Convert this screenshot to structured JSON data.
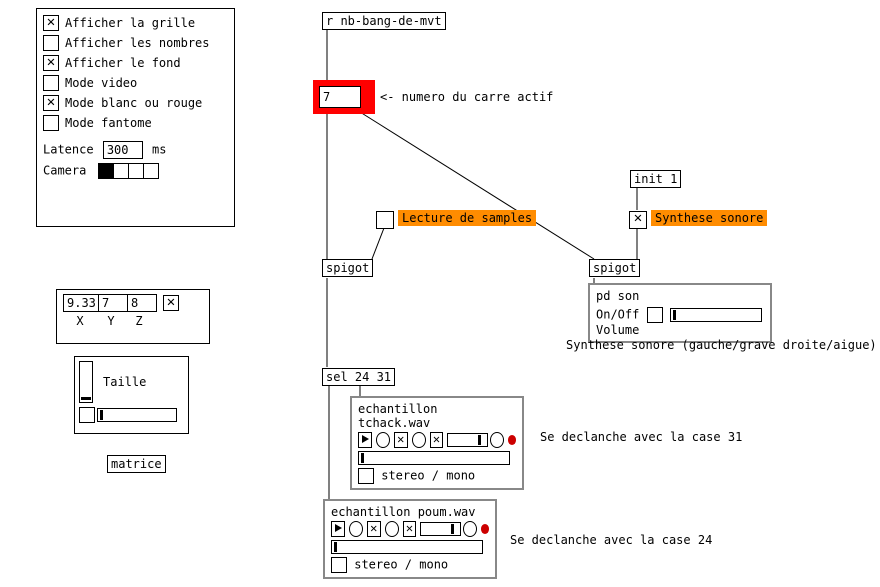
{
  "header": {
    "receive": "r nb-bang-de-mvt",
    "active_label": "<- numero du carre actif",
    "active_value": "7"
  },
  "options": {
    "items": [
      {
        "label": "Afficher la grille",
        "checked": true
      },
      {
        "label": "Afficher les nombres",
        "checked": false
      },
      {
        "label": "Afficher le fond",
        "checked": true
      },
      {
        "label": "Mode video",
        "checked": false
      },
      {
        "label": "Mode blanc ou rouge",
        "checked": true
      },
      {
        "label": "Mode fantome",
        "checked": false
      }
    ],
    "latency_label": "Latence",
    "latency_value": "300",
    "latency_unit": "ms",
    "camera_label": "Camera"
  },
  "xyz": {
    "x": "9.33",
    "y": "7",
    "z": "8",
    "xl": "X",
    "yl": "Y",
    "zl": "Z"
  },
  "taille": {
    "label": "Taille"
  },
  "matrice": {
    "label": "matrice"
  },
  "routing": {
    "init": "init 1",
    "lecture_tgl": false,
    "lecture_label": "Lecture de samples",
    "synth_tgl": true,
    "synth_label": "Synthese sonore",
    "spigot_l": "spigot",
    "spigot_r": "spigot",
    "sel": "sel 24 31",
    "pd_son": {
      "title": "pd son",
      "onoff": "On/Off",
      "vol": "Volume"
    },
    "synth_help": "Synthese sonore (gauche/grave droite/aigue)"
  },
  "samples": {
    "a": {
      "file": "echantillon tchack.wav",
      "mono": "stereo / mono",
      "comment": "Se declanche avec la case 31"
    },
    "b": {
      "file": "echantillon poum.wav",
      "mono": "stereo / mono",
      "comment": "Se declanche avec la case 24"
    }
  }
}
